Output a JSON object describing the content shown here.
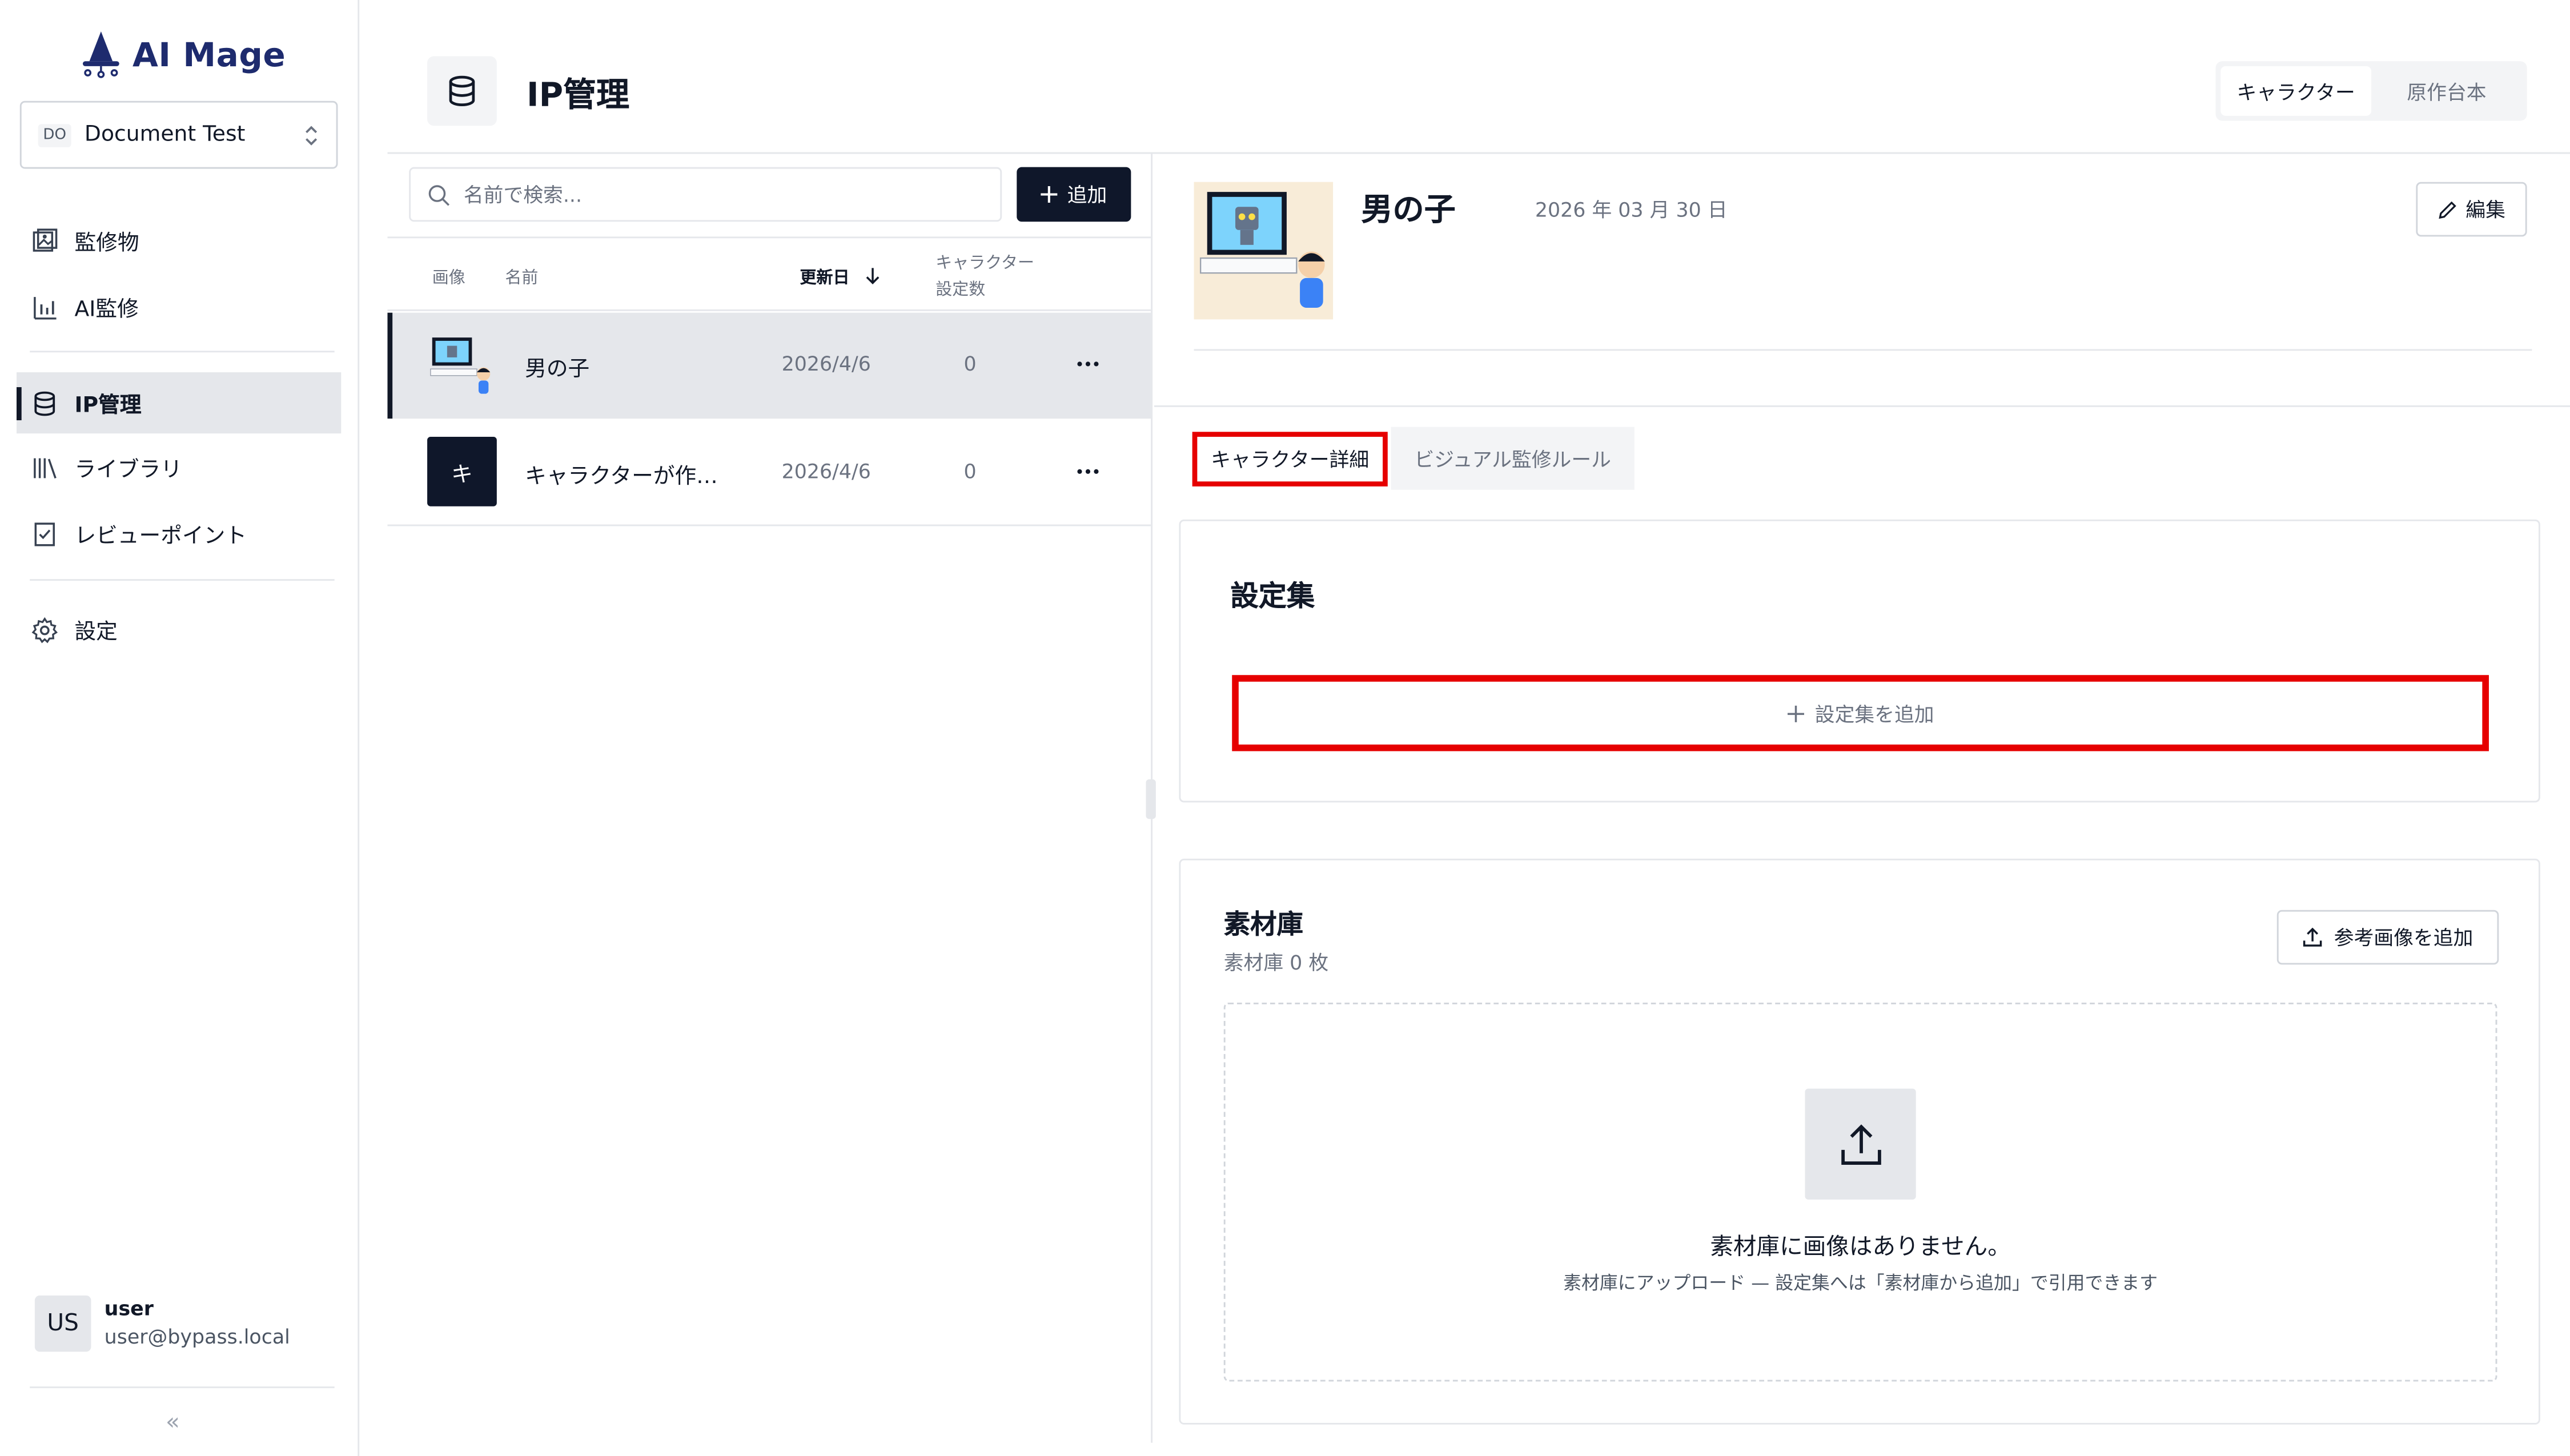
{
  "app": {
    "logo_text": "AI Mage"
  },
  "workspace": {
    "badge": "DO",
    "name": "Document Test"
  },
  "sidebar": {
    "items": [
      {
        "label": "監修物",
        "icon": "image-frame-icon"
      },
      {
        "label": "AI監修",
        "icon": "bar-chart-icon"
      },
      {
        "label": "IP管理",
        "icon": "database-icon",
        "active": true
      },
      {
        "label": "ライブラリ",
        "icon": "library-icon"
      },
      {
        "label": "レビューポイント",
        "icon": "checklist-icon"
      },
      {
        "label": "設定",
        "icon": "gear-icon"
      }
    ],
    "collapse_label": "«"
  },
  "user": {
    "initials": "US",
    "name": "user",
    "email": "user@bypass.local"
  },
  "header": {
    "title": "IP管理",
    "segments": [
      {
        "label": "キャラクター",
        "active": true
      },
      {
        "label": "原作台本",
        "active": false
      }
    ]
  },
  "list": {
    "search_placeholder": "名前で検索...",
    "add_label": "追加",
    "columns": {
      "image": "画像",
      "name": "名前",
      "updated": "更新日",
      "count_line1": "キャラクター",
      "count_line2": "設定数"
    },
    "rows": [
      {
        "thumb": "boy-tv",
        "name": "男の子",
        "date": "2026/4/6",
        "count": "0",
        "selected": true
      },
      {
        "thumb": "キ",
        "name": "キャラクターが作…",
        "date": "2026/4/6",
        "count": "0",
        "selected": false
      }
    ]
  },
  "detail": {
    "name": "男の子",
    "date": "2026 年 03 月 30 日",
    "edit_label": "編集",
    "tabs": [
      {
        "label": "キャラクター詳細",
        "active": true
      },
      {
        "label": "ビジュアル監修ルール",
        "active": false
      }
    ],
    "settings": {
      "title": "設定集",
      "add_label": "設定集を追加"
    },
    "materials": {
      "title": "素材庫",
      "count": "素材庫 0 枚",
      "ref_button": "参考画像を追加",
      "empty_title": "素材庫に画像はありません。",
      "empty_sub": "素材庫にアップロード — 設定集へは「素材庫から追加」で引用できます"
    }
  },
  "colors": {
    "brand": "#1e2b6e",
    "highlight": "#e60000",
    "primary_button": "#0f172a"
  }
}
